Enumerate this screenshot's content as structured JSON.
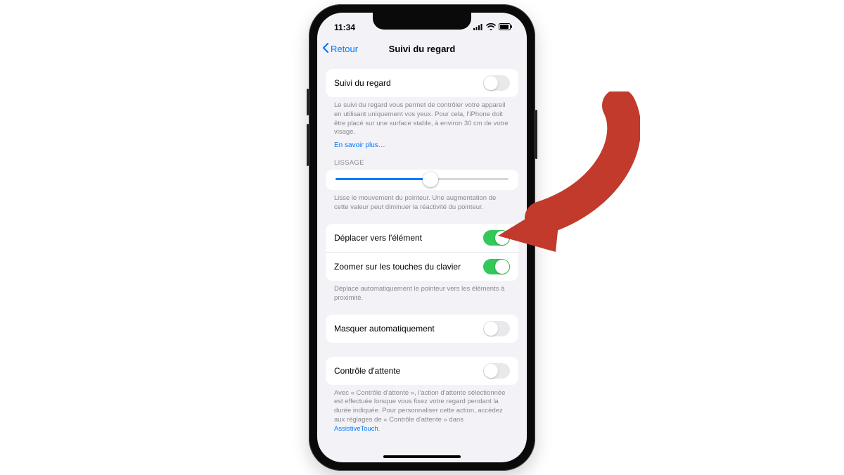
{
  "status": {
    "time": "11:34"
  },
  "nav": {
    "back": "Retour",
    "title": "Suivi du regard"
  },
  "section_main": {
    "row_label": "Suivi du regard",
    "row_on": false,
    "footer": "Le suivi du regard vous permet de contrôler votre appareil en utilisant uniquement vos yeux. Pour cela, l'iPhone doit être placé sur une surface stable, à environ 30 cm de votre visage.",
    "learn_more": "En savoir plus…"
  },
  "section_smoothing": {
    "header": "LISSAGE",
    "slider_percent": 55,
    "footer": "Lisse le mouvement du pointeur. Une augmentation de cette valeur peut diminuer la réactivité du pointeur."
  },
  "section_snap": {
    "rows": [
      {
        "label": "Déplacer vers l'élément",
        "on": true
      },
      {
        "label": "Zoomer sur les touches du clavier",
        "on": true
      }
    ],
    "footer": "Déplace automatiquement le pointeur vers les éléments à proximité."
  },
  "section_hide": {
    "row_label": "Masquer automatiquement",
    "row_on": false
  },
  "section_dwell": {
    "row_label": "Contrôle d'attente",
    "row_on": false,
    "footer_pre": "Avec « Contrôle d'attente », l'action d'attente sélectionnée est effectuée lorsque vous fixez votre regard pendant la durée indiquée. Pour personnaliser cette action, accédez aux réglages de « Contrôle d'attente » dans ",
    "footer_link": "AssistiveTouch",
    "footer_post": "."
  },
  "colors": {
    "accent": "#007aff",
    "toggle_on": "#34c759",
    "arrow": "#c0392b"
  }
}
